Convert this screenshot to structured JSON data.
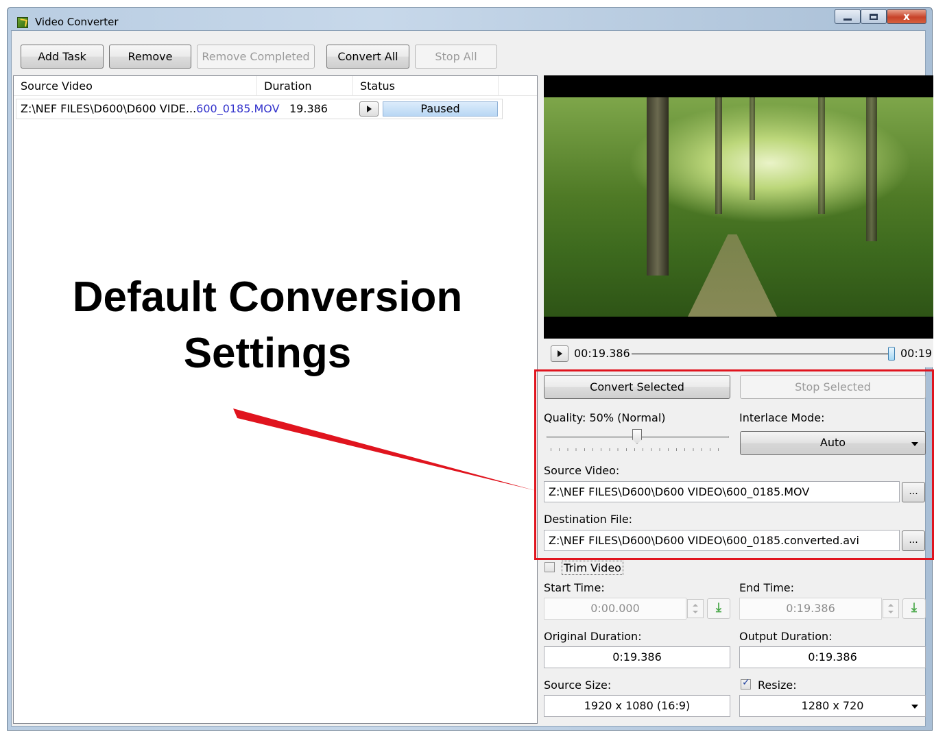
{
  "window": {
    "title": "Video Converter",
    "close_glyph": "x"
  },
  "toolbar": {
    "add_task": "Add Task",
    "remove": "Remove",
    "remove_completed": "Remove Completed",
    "convert_all": "Convert All",
    "stop_all": "Stop All"
  },
  "task_list": {
    "columns": [
      "Source Video",
      "Duration",
      "Status"
    ],
    "rows": [
      {
        "source_prefix": "Z:\\NEF FILES\\D600\\D600 VIDE...",
        "source_suffix": "600_0185.MOV",
        "duration": "19.386",
        "status": "Paused"
      }
    ]
  },
  "annotation": {
    "line1": "Default Conversion",
    "line2": "Settings",
    "callout_color": "#e0141e"
  },
  "player": {
    "current_time": "00:19.386",
    "total_time": "00:19",
    "position_fraction": 1.0
  },
  "actions": {
    "convert_selected": "Convert Selected",
    "stop_selected": "Stop Selected"
  },
  "settings": {
    "quality_label": "Quality: 50% (Normal)",
    "quality_fraction": 0.5,
    "interlace_label": "Interlace Mode:",
    "interlace_value": "Auto",
    "source_video_label": "Source Video:",
    "source_video_value": "Z:\\NEF FILES\\D600\\D600 VIDEO\\600_0185.MOV",
    "destination_label": "Destination File:",
    "destination_value": "Z:\\NEF FILES\\D600\\D600 VIDEO\\600_0185.converted.avi",
    "browse_label": "...",
    "trim_label": "Trim Video",
    "trim_checked": false,
    "start_time_label": "Start Time:",
    "start_time_value": "0:00.000",
    "end_time_label": "End Time:",
    "end_time_value": "0:19.386",
    "original_duration_label": "Original Duration:",
    "original_duration_value": "0:19.386",
    "output_duration_label": "Output Duration:",
    "output_duration_value": "0:19.386",
    "source_size_label": "Source Size:",
    "source_size_value": "1920 x 1080 (16:9)",
    "resize_label": "Resize:",
    "resize_checked": true,
    "resize_value": "1280 x 720"
  }
}
